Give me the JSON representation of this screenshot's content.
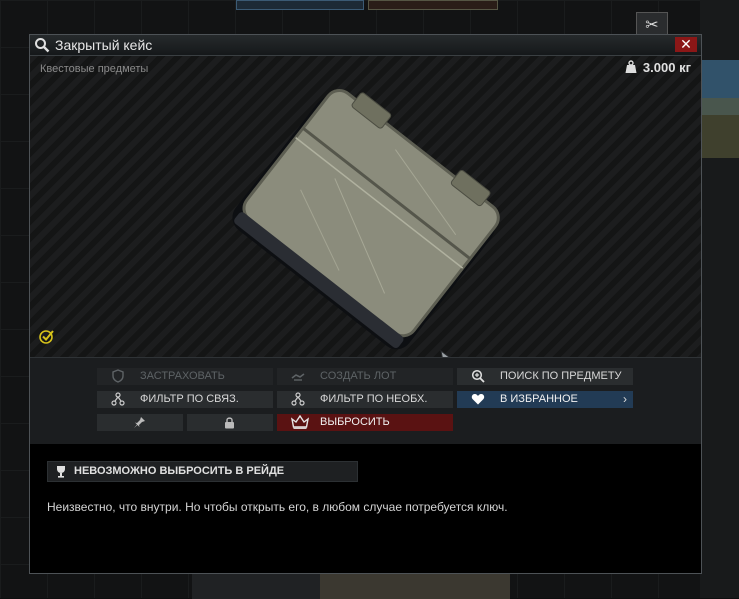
{
  "window": {
    "title": "Закрытый кейс",
    "close_glyph": "✕"
  },
  "preview": {
    "category": "Квестовые предметы",
    "weight": "3.000 кг",
    "icons": [
      "search-icon",
      "weight-icon",
      "quest-check-icon"
    ]
  },
  "actions": {
    "insure": "ЗАСТРАХОВАТЬ",
    "create_offer": "СОЗДАТЬ ЛОТ",
    "search_item": "ПОИСК ПО ПРЕДМЕТУ",
    "filter_linked": "ФИЛЬТР ПО СВЯЗ.",
    "filter_required": "ФИЛЬТР ПО НЕОБХ.",
    "favorite": "В ИЗБРАННОЕ",
    "discard": "ВЫБРОСИТЬ"
  },
  "info": {
    "banner": "НЕВОЗМОЖНО ВЫБРОСИТЬ В РЕЙДЕ",
    "description": "Неизвестно, что внутри. Но чтобы открыть его, в любом случае потребуется ключ."
  },
  "background": {
    "side_button_glyph": "✂"
  },
  "colors": {
    "accent_fav": "#223b55",
    "discard_red": "#5a1212",
    "close_red": "#8b1717",
    "quest_yellow": "#d6c21a"
  }
}
